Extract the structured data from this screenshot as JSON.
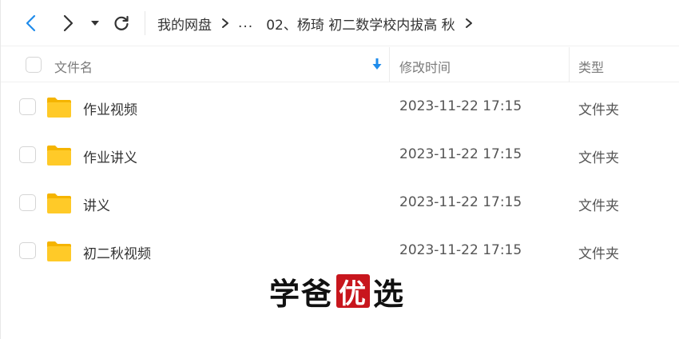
{
  "toolbar": {
    "back_icon": "chevron-left-icon",
    "forward_icon": "chevron-right-icon",
    "history_icon": "caret-down-icon",
    "refresh_icon": "refresh-icon",
    "accent_color": "#1f8ceb"
  },
  "breadcrumb": {
    "root": "我的网盘",
    "ellipsis": "...",
    "current": "02、杨琦 初二数学校内拔高 秋"
  },
  "header": {
    "name": "文件名",
    "modified": "修改时间",
    "type": "类型",
    "sort_icon": "sort-down-arrow-icon"
  },
  "files": [
    {
      "name": "作业视频",
      "modified": "2023-11-22 17:15",
      "type": "文件夹"
    },
    {
      "name": "作业讲义",
      "modified": "2023-11-22 17:15",
      "type": "文件夹"
    },
    {
      "name": "讲义",
      "modified": "2023-11-22 17:15",
      "type": "文件夹"
    },
    {
      "name": "初二秋视频",
      "modified": "2023-11-22 17:15",
      "type": "文件夹"
    }
  ],
  "watermark": {
    "char1": "学",
    "char2": "爸",
    "char3": "优",
    "char4": "选",
    "seal_color": "#c8161d"
  }
}
